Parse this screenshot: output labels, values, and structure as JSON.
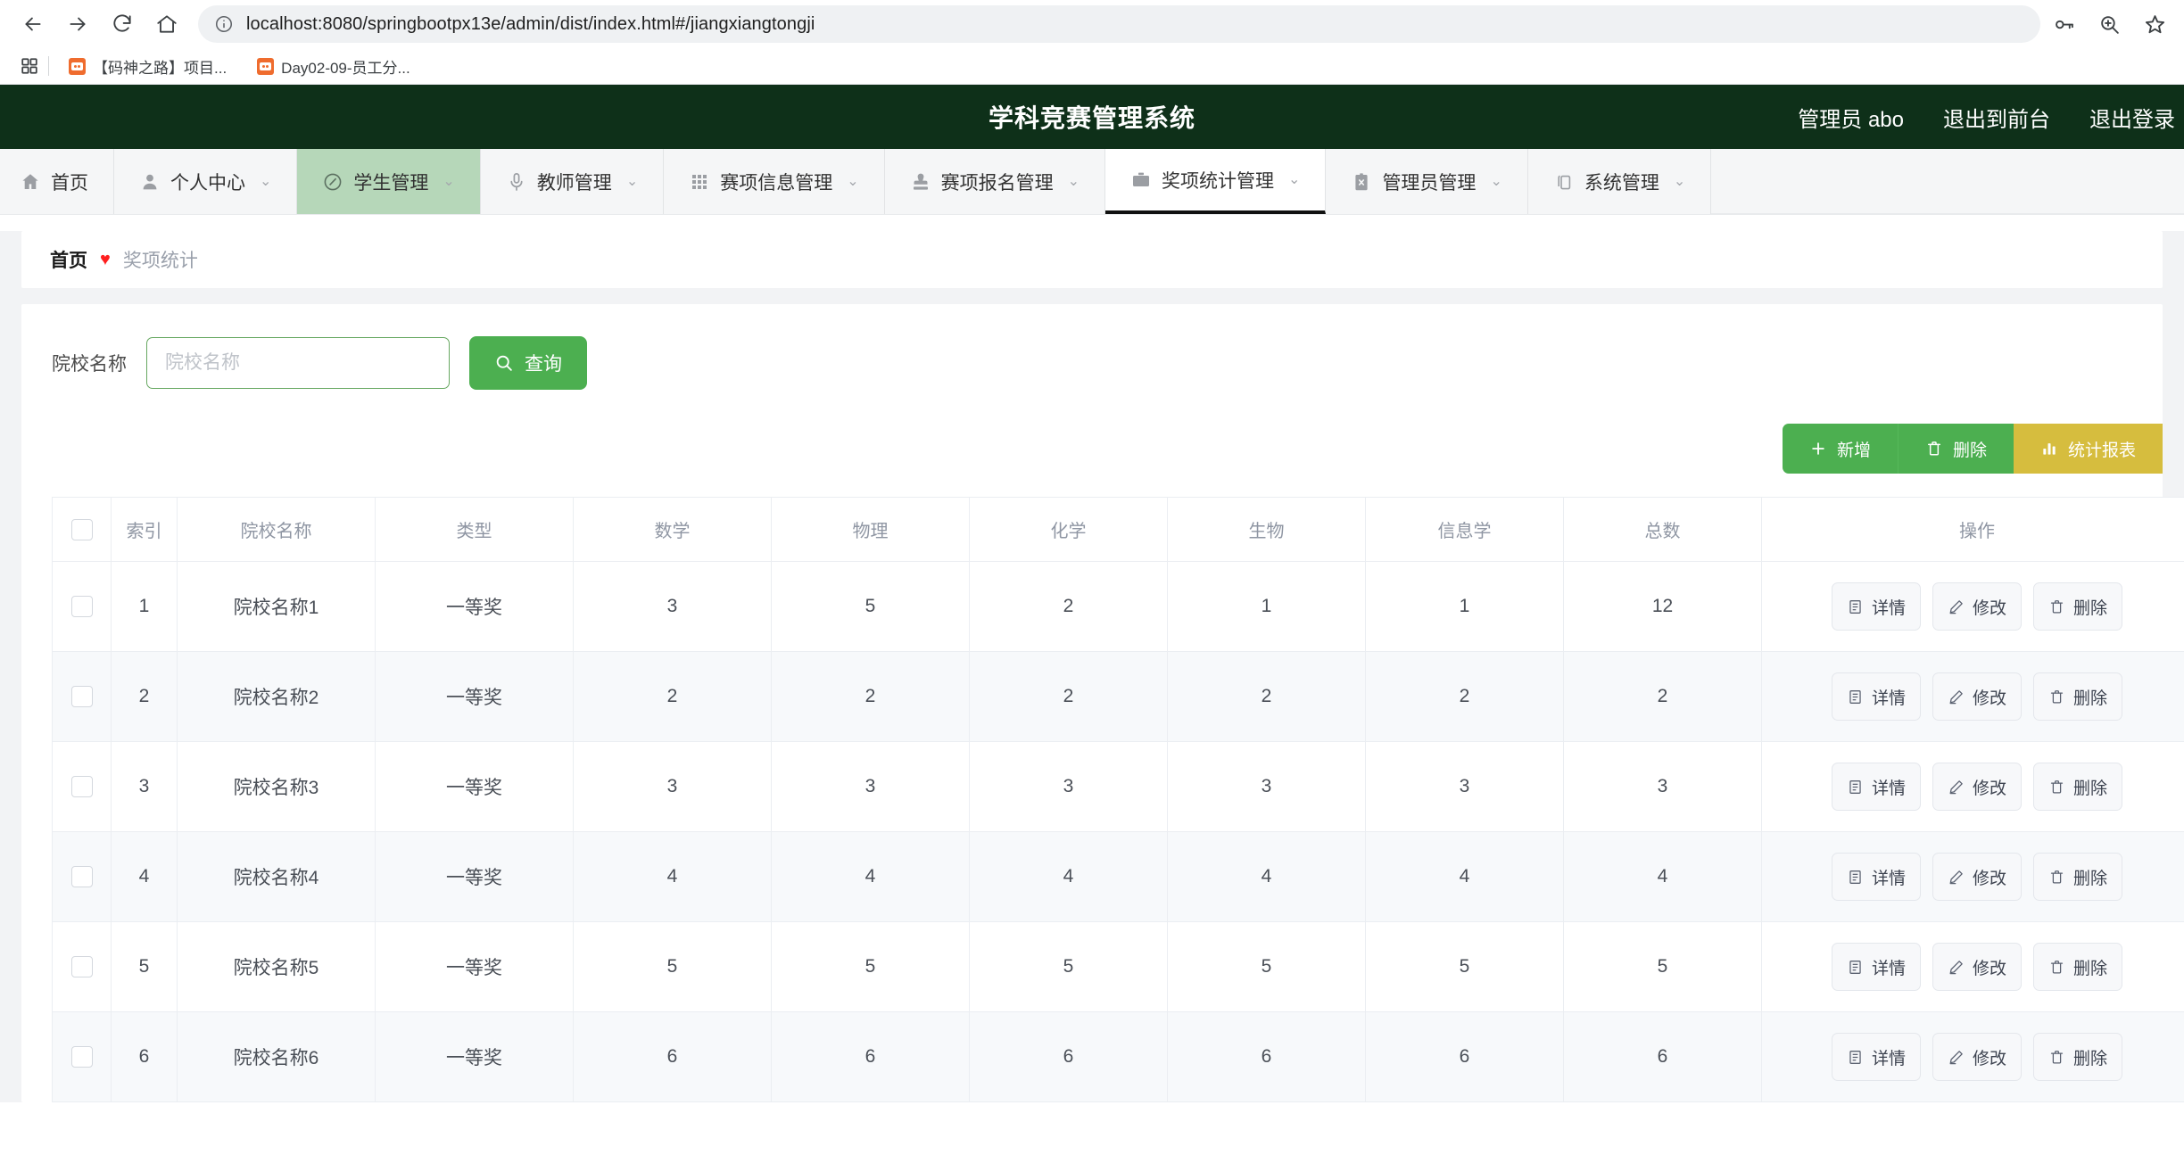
{
  "browser": {
    "url": "localhost:8080/springbootpx13e/admin/dist/index.html#/jiangxiangtongji",
    "back_icon": "back-arrow-icon",
    "forward_icon": "forward-arrow-icon",
    "reload_icon": "reload-icon",
    "home_icon": "home-icon",
    "info_icon": "site-info-icon",
    "password_icon": "password-key-icon",
    "zoom_icon": "zoom-in-icon",
    "bookmark_icon": "bookmark-star-icon",
    "apps_icon": "apps-grid-icon",
    "bookmarks": [
      {
        "label": "【码神之路】项目...",
        "favicon": "bookmark-favicon"
      },
      {
        "label": "Day02-09-员工分...",
        "favicon": "bookmark-favicon"
      }
    ]
  },
  "header": {
    "title": "学科竞赛管理系统",
    "user_label": "管理员 abo",
    "exit_front_label": "退出到前台",
    "logout_label": "退出登录",
    "bg_color": "#0e3019"
  },
  "nav": {
    "items": [
      {
        "label": "首页",
        "icon": "home-icon",
        "state": "normal",
        "caret": false
      },
      {
        "label": "个人中心",
        "icon": "user-icon",
        "state": "normal",
        "caret": true
      },
      {
        "label": "学生管理",
        "icon": "circle-slash-icon",
        "state": "selected",
        "caret": true
      },
      {
        "label": "教师管理",
        "icon": "microphone-icon",
        "state": "normal",
        "caret": true
      },
      {
        "label": "赛项信息管理",
        "icon": "grid-dots-icon",
        "state": "normal",
        "caret": true
      },
      {
        "label": "赛项报名管理",
        "icon": "stamp-icon",
        "state": "normal",
        "caret": true
      },
      {
        "label": "奖项统计管理",
        "icon": "briefcase-icon",
        "state": "active",
        "caret": true
      },
      {
        "label": "管理员管理",
        "icon": "clipboard-x-icon",
        "state": "normal",
        "caret": true
      },
      {
        "label": "系统管理",
        "icon": "copy-icon",
        "state": "normal",
        "caret": true
      }
    ],
    "selected_bg": "#b6d7b9",
    "active_underline": "#111111"
  },
  "breadcrumb": {
    "home": "首页",
    "separator": "♥",
    "separator_color": "#ff1f1f",
    "current": "奖项统计"
  },
  "search": {
    "label": "院校名称",
    "placeholder": "院校名称",
    "value": "",
    "button_label": "查询",
    "button_icon": "search-icon",
    "button_color": "#4caf50"
  },
  "toolbar": {
    "buttons": [
      {
        "label": "新增",
        "icon": "plus-icon",
        "color": "#4caf50"
      },
      {
        "label": "删除",
        "icon": "trash-icon",
        "color": "#4caf50"
      },
      {
        "label": "统计报表",
        "icon": "bar-chart-icon",
        "color": "#d6bd3e"
      }
    ]
  },
  "table": {
    "select_all_checkbox": false,
    "columns": [
      "",
      "索引",
      "院校名称",
      "类型",
      "数学",
      "物理",
      "化学",
      "生物",
      "信息学",
      "总数",
      "操作"
    ],
    "row_actions": [
      {
        "label": "详情",
        "icon": "detail-doc-icon"
      },
      {
        "label": "修改",
        "icon": "pencil-icon"
      },
      {
        "label": "删除",
        "icon": "trash-icon"
      }
    ],
    "rows": [
      {
        "index": "1",
        "name": "院校名称1",
        "type": "一等奖",
        "math": "3",
        "physics": "5",
        "chemistry": "2",
        "biology": "1",
        "informatics": "1",
        "total": "12"
      },
      {
        "index": "2",
        "name": "院校名称2",
        "type": "一等奖",
        "math": "2",
        "physics": "2",
        "chemistry": "2",
        "biology": "2",
        "informatics": "2",
        "total": "2"
      },
      {
        "index": "3",
        "name": "院校名称3",
        "type": "一等奖",
        "math": "3",
        "physics": "3",
        "chemistry": "3",
        "biology": "3",
        "informatics": "3",
        "total": "3"
      },
      {
        "index": "4",
        "name": "院校名称4",
        "type": "一等奖",
        "math": "4",
        "physics": "4",
        "chemistry": "4",
        "biology": "4",
        "informatics": "4",
        "total": "4"
      },
      {
        "index": "5",
        "name": "院校名称5",
        "type": "一等奖",
        "math": "5",
        "physics": "5",
        "chemistry": "5",
        "biology": "5",
        "informatics": "5",
        "total": "5"
      },
      {
        "index": "6",
        "name": "院校名称6",
        "type": "一等奖",
        "math": "6",
        "physics": "6",
        "chemistry": "6",
        "biology": "6",
        "informatics": "6",
        "total": "6"
      }
    ]
  }
}
